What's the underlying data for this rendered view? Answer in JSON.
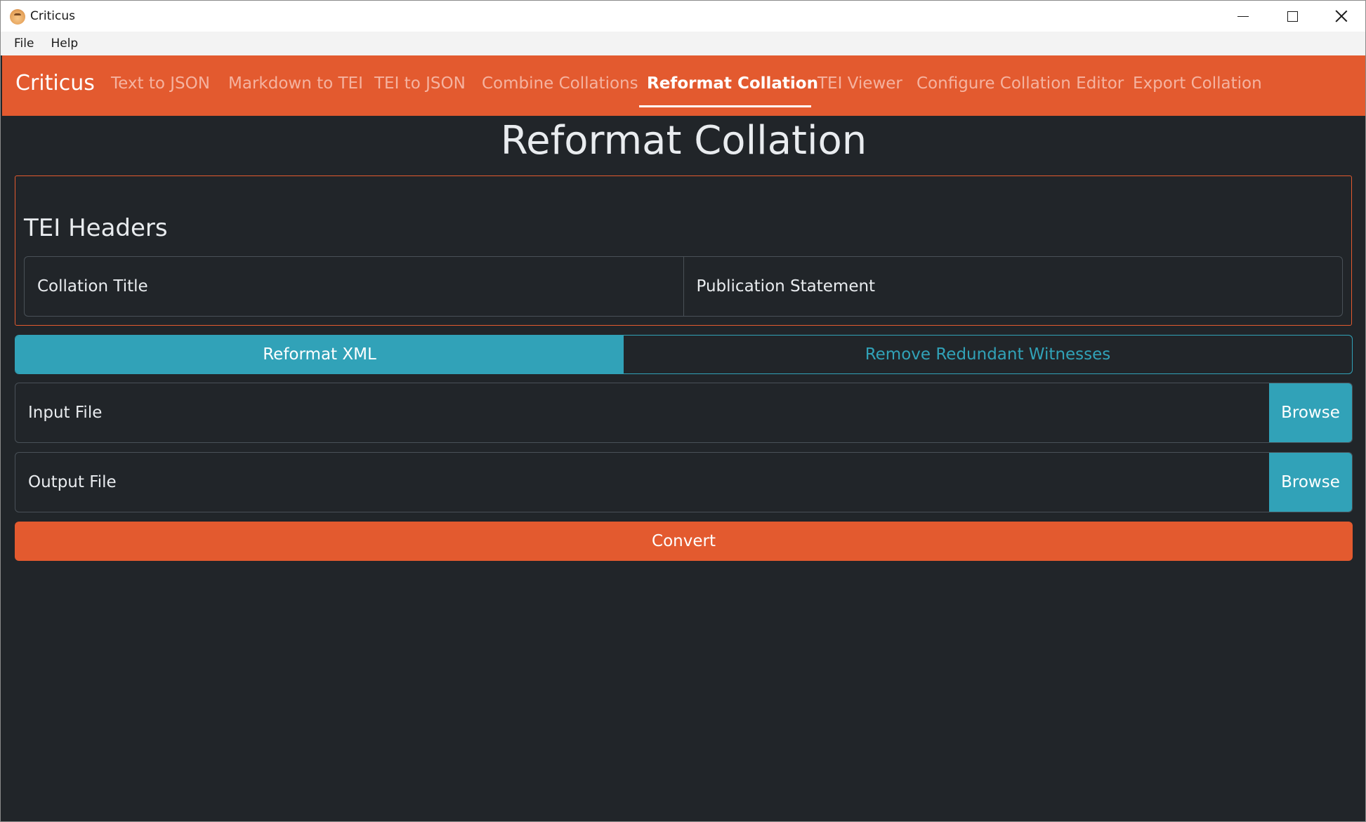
{
  "window": {
    "title": "Criticus",
    "controls": [
      "minimize-icon",
      "maximize-icon",
      "close-icon"
    ]
  },
  "menu": {
    "items": [
      "File",
      "Help"
    ]
  },
  "navbar": {
    "brand": "Criticus",
    "links": [
      "Text to JSON",
      "Markdown to TEI",
      "TEI to JSON",
      "Combine Collations",
      "Reformat Collation",
      "TEI Viewer",
      "Configure Collation Editor",
      "Export Collation"
    ],
    "active": "Reformat Collation"
  },
  "main": {
    "title": "Reformat Collation",
    "tei_headers": {
      "heading": "TEI Headers",
      "collation_title_label": "Collation Title",
      "publication_statement_label": "Publication Statement"
    },
    "mode_toggle": {
      "selected": "Reformat XML",
      "other": "Remove Redundant Witnesses"
    },
    "input_file": {
      "label": "Input File",
      "button": "Browse"
    },
    "output_file": {
      "label": "Output File",
      "button": "Browse"
    },
    "convert_button": "Convert"
  },
  "colors": {
    "accent": "#e35a2f",
    "info": "#31a2b8",
    "background": "#212529"
  }
}
